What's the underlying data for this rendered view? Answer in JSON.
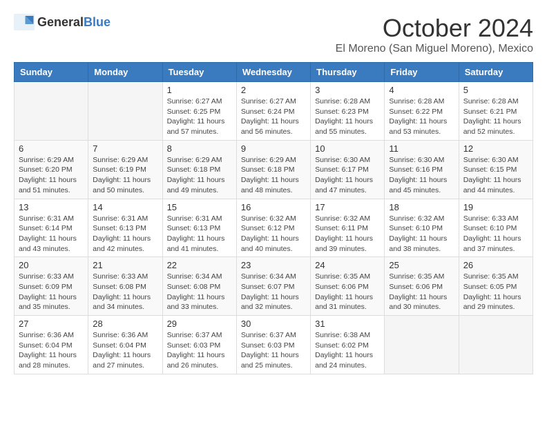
{
  "logo": {
    "general": "General",
    "blue": "Blue"
  },
  "title": "October 2024",
  "location": "El Moreno (San Miguel Moreno), Mexico",
  "days_of_week": [
    "Sunday",
    "Monday",
    "Tuesday",
    "Wednesday",
    "Thursday",
    "Friday",
    "Saturday"
  ],
  "weeks": [
    [
      {
        "day": "",
        "info": ""
      },
      {
        "day": "",
        "info": ""
      },
      {
        "day": "1",
        "info": "Sunrise: 6:27 AM\nSunset: 6:25 PM\nDaylight: 11 hours and 57 minutes."
      },
      {
        "day": "2",
        "info": "Sunrise: 6:27 AM\nSunset: 6:24 PM\nDaylight: 11 hours and 56 minutes."
      },
      {
        "day": "3",
        "info": "Sunrise: 6:28 AM\nSunset: 6:23 PM\nDaylight: 11 hours and 55 minutes."
      },
      {
        "day": "4",
        "info": "Sunrise: 6:28 AM\nSunset: 6:22 PM\nDaylight: 11 hours and 53 minutes."
      },
      {
        "day": "5",
        "info": "Sunrise: 6:28 AM\nSunset: 6:21 PM\nDaylight: 11 hours and 52 minutes."
      }
    ],
    [
      {
        "day": "6",
        "info": "Sunrise: 6:29 AM\nSunset: 6:20 PM\nDaylight: 11 hours and 51 minutes."
      },
      {
        "day": "7",
        "info": "Sunrise: 6:29 AM\nSunset: 6:19 PM\nDaylight: 11 hours and 50 minutes."
      },
      {
        "day": "8",
        "info": "Sunrise: 6:29 AM\nSunset: 6:18 PM\nDaylight: 11 hours and 49 minutes."
      },
      {
        "day": "9",
        "info": "Sunrise: 6:29 AM\nSunset: 6:18 PM\nDaylight: 11 hours and 48 minutes."
      },
      {
        "day": "10",
        "info": "Sunrise: 6:30 AM\nSunset: 6:17 PM\nDaylight: 11 hours and 47 minutes."
      },
      {
        "day": "11",
        "info": "Sunrise: 6:30 AM\nSunset: 6:16 PM\nDaylight: 11 hours and 45 minutes."
      },
      {
        "day": "12",
        "info": "Sunrise: 6:30 AM\nSunset: 6:15 PM\nDaylight: 11 hours and 44 minutes."
      }
    ],
    [
      {
        "day": "13",
        "info": "Sunrise: 6:31 AM\nSunset: 6:14 PM\nDaylight: 11 hours and 43 minutes."
      },
      {
        "day": "14",
        "info": "Sunrise: 6:31 AM\nSunset: 6:13 PM\nDaylight: 11 hours and 42 minutes."
      },
      {
        "day": "15",
        "info": "Sunrise: 6:31 AM\nSunset: 6:13 PM\nDaylight: 11 hours and 41 minutes."
      },
      {
        "day": "16",
        "info": "Sunrise: 6:32 AM\nSunset: 6:12 PM\nDaylight: 11 hours and 40 minutes."
      },
      {
        "day": "17",
        "info": "Sunrise: 6:32 AM\nSunset: 6:11 PM\nDaylight: 11 hours and 39 minutes."
      },
      {
        "day": "18",
        "info": "Sunrise: 6:32 AM\nSunset: 6:10 PM\nDaylight: 11 hours and 38 minutes."
      },
      {
        "day": "19",
        "info": "Sunrise: 6:33 AM\nSunset: 6:10 PM\nDaylight: 11 hours and 37 minutes."
      }
    ],
    [
      {
        "day": "20",
        "info": "Sunrise: 6:33 AM\nSunset: 6:09 PM\nDaylight: 11 hours and 35 minutes."
      },
      {
        "day": "21",
        "info": "Sunrise: 6:33 AM\nSunset: 6:08 PM\nDaylight: 11 hours and 34 minutes."
      },
      {
        "day": "22",
        "info": "Sunrise: 6:34 AM\nSunset: 6:08 PM\nDaylight: 11 hours and 33 minutes."
      },
      {
        "day": "23",
        "info": "Sunrise: 6:34 AM\nSunset: 6:07 PM\nDaylight: 11 hours and 32 minutes."
      },
      {
        "day": "24",
        "info": "Sunrise: 6:35 AM\nSunset: 6:06 PM\nDaylight: 11 hours and 31 minutes."
      },
      {
        "day": "25",
        "info": "Sunrise: 6:35 AM\nSunset: 6:06 PM\nDaylight: 11 hours and 30 minutes."
      },
      {
        "day": "26",
        "info": "Sunrise: 6:35 AM\nSunset: 6:05 PM\nDaylight: 11 hours and 29 minutes."
      }
    ],
    [
      {
        "day": "27",
        "info": "Sunrise: 6:36 AM\nSunset: 6:04 PM\nDaylight: 11 hours and 28 minutes."
      },
      {
        "day": "28",
        "info": "Sunrise: 6:36 AM\nSunset: 6:04 PM\nDaylight: 11 hours and 27 minutes."
      },
      {
        "day": "29",
        "info": "Sunrise: 6:37 AM\nSunset: 6:03 PM\nDaylight: 11 hours and 26 minutes."
      },
      {
        "day": "30",
        "info": "Sunrise: 6:37 AM\nSunset: 6:03 PM\nDaylight: 11 hours and 25 minutes."
      },
      {
        "day": "31",
        "info": "Sunrise: 6:38 AM\nSunset: 6:02 PM\nDaylight: 11 hours and 24 minutes."
      },
      {
        "day": "",
        "info": ""
      },
      {
        "day": "",
        "info": ""
      }
    ]
  ]
}
